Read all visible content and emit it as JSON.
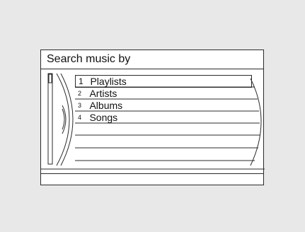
{
  "screen": {
    "title": "Search music by"
  },
  "menu": {
    "items": [
      {
        "number": "1",
        "label": "Playlists",
        "selected": true
      },
      {
        "number": "2",
        "label": "Artists",
        "selected": false
      },
      {
        "number": "3",
        "label": "Albums",
        "selected": false
      },
      {
        "number": "4",
        "label": "Songs",
        "selected": false
      }
    ]
  }
}
